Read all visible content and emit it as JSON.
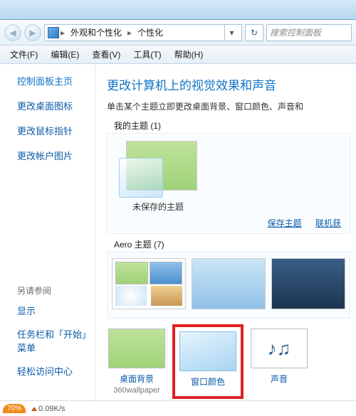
{
  "breadcrumb": {
    "root_icon": "monitor",
    "level1": "外观和个性化",
    "level2": "个性化"
  },
  "search": {
    "placeholder": "搜索控制面板"
  },
  "menubar": {
    "file": "文件(F)",
    "edit": "编辑(E)",
    "view": "查看(V)",
    "tools": "工具(T)",
    "help": "帮助(H)"
  },
  "sidebar": {
    "home": "控制面板主页",
    "links": [
      "更改桌面图标",
      "更改鼠标指针",
      "更改帐户图片"
    ],
    "see_also_heading": "另请参阅",
    "see_also": [
      "显示",
      "任务栏和「开始」菜单",
      "轻松访问中心"
    ]
  },
  "content": {
    "title": "更改计算机上的视觉效果和声音",
    "subtitle": "单击某个主题立即更改桌面背景、窗口颜色、声音和",
    "my_themes_label": "我的主题 (1)",
    "unsaved_theme_caption": "未保存的主题",
    "save_theme": "保存主题",
    "get_online": "联机获",
    "aero_label": "Aero 主题 (7)",
    "bottom": {
      "wallpaper_label": "桌面背景",
      "wallpaper_sub": "360wallpaper",
      "window_color_label": "窗口颜色",
      "sound_label": "声音"
    }
  },
  "status": {
    "zoom": "70%",
    "speed": "0.09K/s"
  }
}
